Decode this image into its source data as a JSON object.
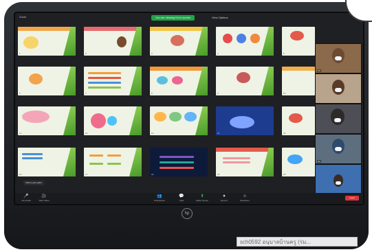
{
  "meeting": {
    "left_title": "Zoom",
    "share_banner": "You are viewing Kru's screen",
    "view_options": "View Options"
  },
  "tooltip": "Click to join audio",
  "toolbar": {
    "items": [
      {
        "icon": "🎤",
        "label": "Join Audio"
      },
      {
        "icon": "🎥",
        "label": "Start Video"
      },
      {
        "icon": "👥",
        "label": "Participants"
      },
      {
        "icon": "💬",
        "label": "Chat"
      },
      {
        "icon": "⬆",
        "label": "Share Screen"
      },
      {
        "icon": "⏺",
        "label": "Record"
      },
      {
        "icon": "☺",
        "label": "Reactions"
      }
    ],
    "leave_label": "Leave"
  },
  "slide_numbers": [
    "1",
    "2",
    "3",
    "4",
    "5",
    "6",
    "7",
    "8",
    "9",
    "10",
    "11",
    "12",
    "13",
    "14",
    "15",
    "16",
    "17",
    "18",
    "19",
    "20"
  ],
  "participants": [
    "PC",
    "",
    "",
    "Ka",
    ""
  ],
  "logo_text": "hp",
  "sticker_text": "sch0592  อนุบาลบ้านครู (ร่ม..."
}
